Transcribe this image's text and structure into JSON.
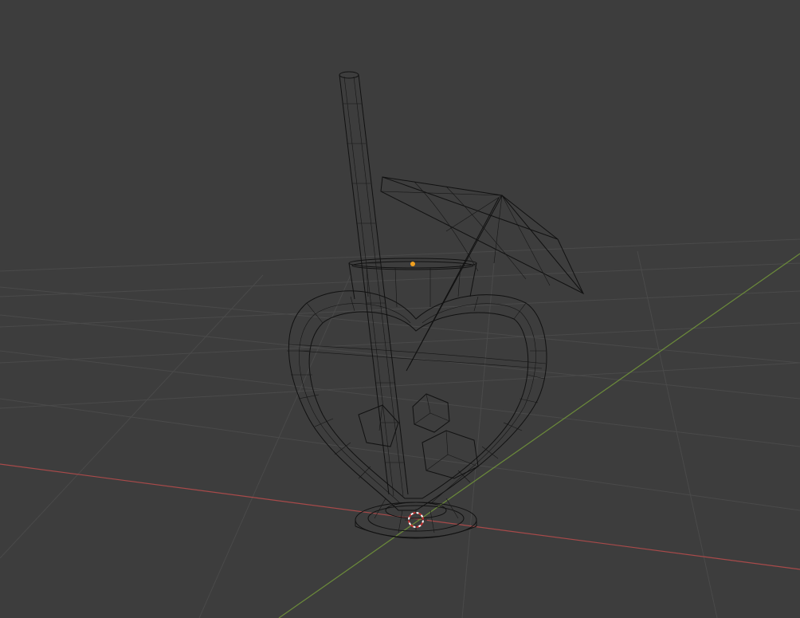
{
  "viewport": {
    "mode": "wireframe",
    "background_color": "#3d3d3d",
    "grid_color": "#4a4a4a",
    "wire_color": "#111111",
    "x_axis_color": "#a84a4a",
    "y_axis_color": "#6b8a3a",
    "origin_color": "#f0a020",
    "cursor_colors": [
      "#ffffff",
      "#c83030"
    ]
  },
  "scene": {
    "objects": [
      "heart-glass",
      "straw",
      "cocktail-umbrella",
      "ice-cubes"
    ]
  }
}
